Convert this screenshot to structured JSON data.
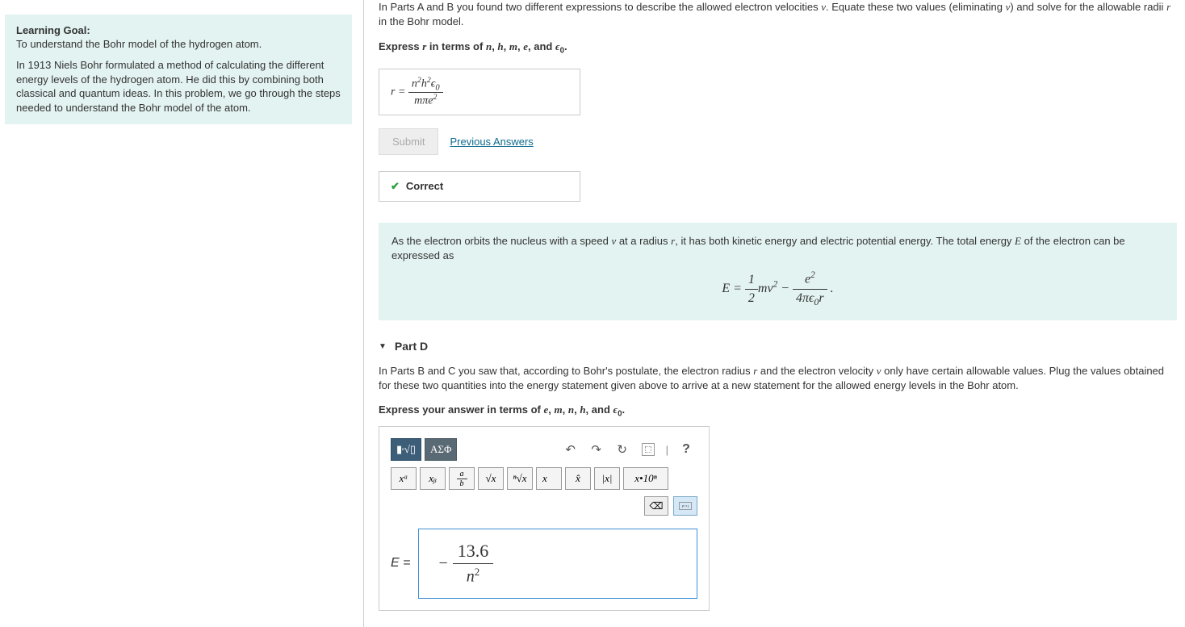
{
  "sidebar": {
    "goal_title": "Learning Goal:",
    "goal_sub": "To understand the Bohr model of the hydrogen atom.",
    "goal_body": "In 1913 Niels Bohr formulated a method of calculating the different energy levels of the hydrogen atom. He did this by combining both classical and quantum ideas. In this problem, we go through the steps needed to understand the Bohr model of the atom."
  },
  "partC": {
    "top_instr_a": "In Parts A and B you found two different expressions to describe the allowed electron velocities ",
    "top_instr_b": ". Equate these two values (eliminating ",
    "top_instr_c": ") and solve for the allowable radii ",
    "top_instr_d": " in the Bohr model.",
    "express_prefix": "Express ",
    "express_mid": " in terms of ",
    "express_suffix": ".",
    "answer_lhs": "r =",
    "answer_num": "n²h²ϵ₀",
    "answer_den": "mπe²",
    "submit_label": "Submit",
    "prev_label": "Previous Answers",
    "correct_label": "Correct"
  },
  "info": {
    "text_a": "As the electron orbits the nucleus with a speed ",
    "text_b": " at a radius ",
    "text_c": ", it has both kinetic energy and electric potential energy. The total energy ",
    "text_d": " of the electron can be expressed as",
    "eq_lhs": "E = ",
    "eq_frac1_num": "1",
    "eq_frac1_den": "2",
    "eq_mid": "mv² − ",
    "eq_frac2_num": "e²",
    "eq_frac2_den": "4πϵ₀r",
    "eq_end": " ."
  },
  "partD": {
    "header": "Part D",
    "desc": "In Parts B and C you saw that, according to Bohr's postulate, the electron radius r and the electron velocity v only have certain allowable values. Plug the values obtained for these two quantities into the energy statement given above to arrive at a new statement for the allowed energy levels in the Bohr atom.",
    "express_prefix": "Express your answer in terms of ",
    "express_suffix": ".",
    "greek_label": "ΑΣΦ",
    "help_label": "?",
    "tools": {
      "xa": "xᵃ",
      "xb": "xᵦ",
      "ab_num": "a",
      "ab_den": "b",
      "sqrt": "√x",
      "nroot": "ⁿ√x",
      "vec": "x⃗",
      "hat": "x̂",
      "abs": "|x|",
      "sci": "x•10ⁿ"
    },
    "eq_lhs": "E =",
    "eq_num": "13.6",
    "eq_den": "n²"
  }
}
